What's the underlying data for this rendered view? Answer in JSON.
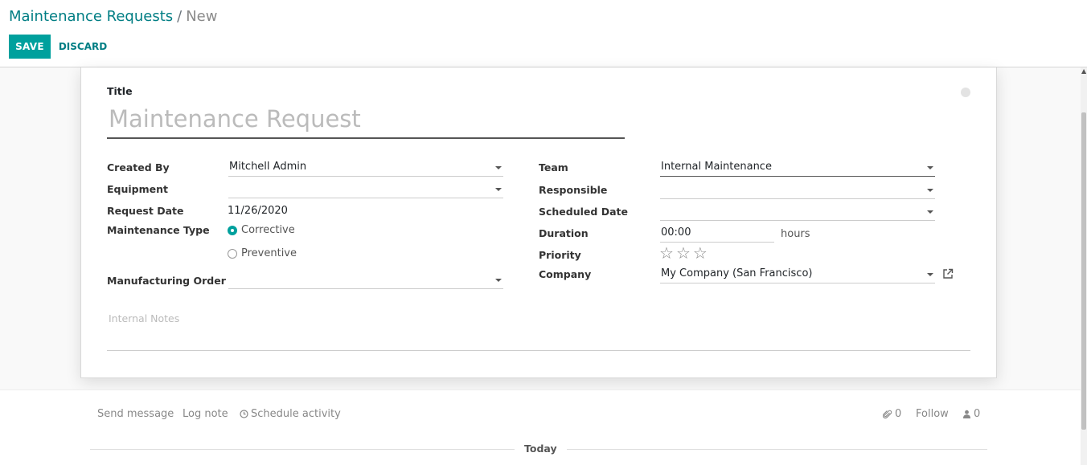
{
  "breadcrumb": {
    "parent": "Maintenance Requests",
    "separator": "/",
    "current": "New"
  },
  "buttons": {
    "save": "SAVE",
    "discard": "DISCARD"
  },
  "form": {
    "title_label": "Title",
    "title_placeholder": "Maintenance Request",
    "left": {
      "created_by": {
        "label": "Created By",
        "value": "Mitchell Admin"
      },
      "equipment": {
        "label": "Equipment",
        "value": ""
      },
      "request_date": {
        "label": "Request Date",
        "value": "11/26/2020"
      },
      "maintenance_type": {
        "label": "Maintenance Type",
        "options": [
          "Corrective",
          "Preventive"
        ],
        "selected": "Corrective"
      },
      "manufacturing_order": {
        "label": "Manufacturing Order",
        "value": ""
      }
    },
    "right": {
      "team": {
        "label": "Team",
        "value": "Internal Maintenance"
      },
      "responsible": {
        "label": "Responsible",
        "value": ""
      },
      "scheduled_date": {
        "label": "Scheduled Date",
        "value": ""
      },
      "duration": {
        "label": "Duration",
        "value": "00:00",
        "unit": "hours"
      },
      "priority": {
        "label": "Priority",
        "stars": 3,
        "value": 0
      },
      "company": {
        "label": "Company",
        "value": "My Company (San Francisco)"
      }
    },
    "notes_placeholder": "Internal Notes"
  },
  "chatter": {
    "send_message": "Send message",
    "log_note": "Log note",
    "schedule_activity": "Schedule activity",
    "attachments_count": "0",
    "follow": "Follow",
    "followers_count": "0",
    "today": "Today"
  },
  "colors": {
    "primary": "#00a09d",
    "link": "#017e84"
  }
}
